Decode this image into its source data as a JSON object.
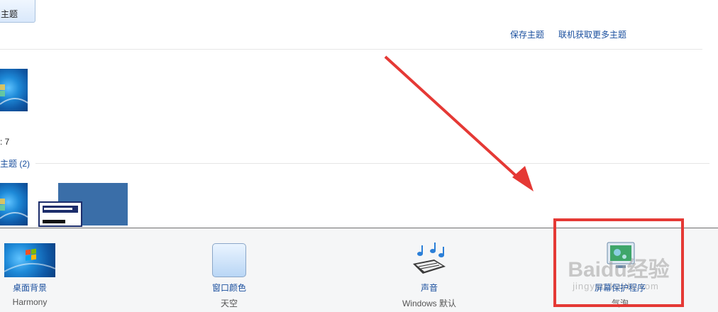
{
  "top": {
    "partial_button_label": "主题",
    "save_theme_link": "保存主题",
    "get_more_themes_link": "联机获取更多主题"
  },
  "themes": {
    "aero_partial_label": ": 7",
    "basic_section_label": "主题 (2)"
  },
  "bottom": {
    "tiles": [
      {
        "title": "桌面背景",
        "subtitle": "Harmony"
      },
      {
        "title": "窗口颜色",
        "subtitle": "天空"
      },
      {
        "title": "声音",
        "subtitle": "Windows 默认"
      },
      {
        "title": "屏幕保护程序",
        "subtitle": "气泡"
      }
    ]
  },
  "watermark": {
    "main": "Baidu经验",
    "sub": "jingyan.baidu.com"
  },
  "colors": {
    "link": "#1a4f9e",
    "highlight": "#e53935",
    "arrow": "#e53935"
  },
  "icons": [
    "win7-logo-icon",
    "color-swatch-icon",
    "music-note-icon",
    "screensaver-icon"
  ]
}
